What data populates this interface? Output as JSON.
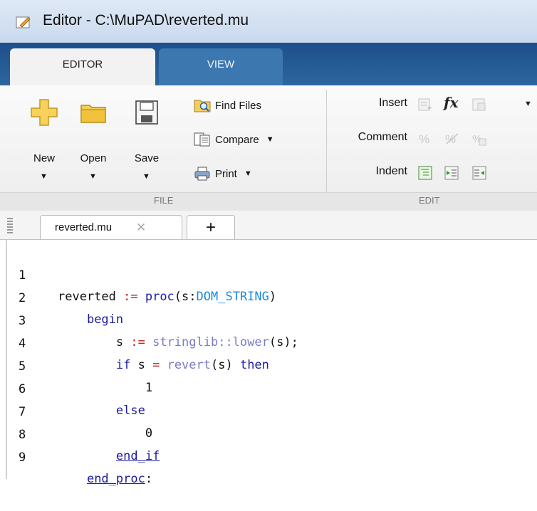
{
  "window": {
    "title": "Editor - C:\\MuPAD\\reverted.mu"
  },
  "tabs": [
    {
      "label": "EDITOR"
    },
    {
      "label": "VIEW"
    }
  ],
  "ribbon": {
    "file": {
      "section_label": "FILE",
      "new_label": "New",
      "open_label": "Open",
      "save_label": "Save",
      "find_files_label": "Find Files",
      "compare_label": "Compare",
      "print_label": "Print"
    },
    "edit": {
      "section_label": "EDIT",
      "insert_label": "Insert",
      "comment_label": "Comment",
      "indent_label": "Indent",
      "fx_label": "fx"
    }
  },
  "file_tabs": {
    "active": "reverted.mu",
    "close_glyph": "✕",
    "add_glyph": "+"
  },
  "code": {
    "lines": [
      {
        "n": "1",
        "indent": "",
        "t1": "reverted ",
        "t2": ":=",
        "t3": " proc",
        "t4": "(s:",
        "t5": "DOM_STRING",
        "t6": ")"
      },
      {
        "n": "2",
        "indent": "    ",
        "kw": "begin"
      },
      {
        "n": "3",
        "indent": "        ",
        "t1": "s ",
        "t2": ":=",
        "t3": " stringlib::lower",
        "t4": "(s);"
      },
      {
        "n": "4",
        "indent": "        ",
        "t1": "if",
        "t2": " s ",
        "t3": "=",
        "t4": " revert",
        "t5": "(s) ",
        "t6": "then"
      },
      {
        "n": "5",
        "indent": "            ",
        "val": "1"
      },
      {
        "n": "6",
        "indent": "        ",
        "kw": "else"
      },
      {
        "n": "7",
        "indent": "            ",
        "val": "0"
      },
      {
        "n": "8",
        "indent": "        ",
        "kw": "end_if"
      },
      {
        "n": "9",
        "indent": "    ",
        "kw": "end_proc",
        "tail": ":"
      }
    ]
  }
}
